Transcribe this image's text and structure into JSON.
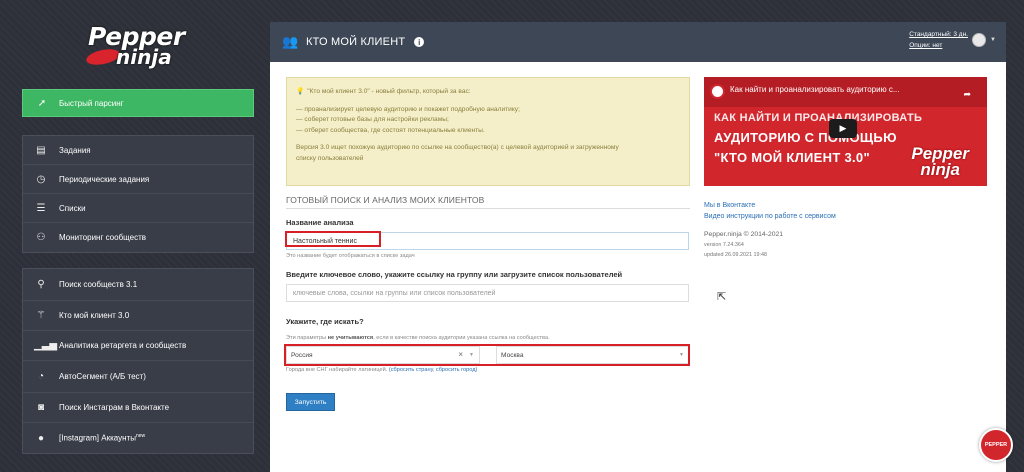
{
  "logo": {
    "line1": "Pepper",
    "line2": "ninja"
  },
  "sidebar": {
    "quick_parse": {
      "label": "Быстрый парсинг",
      "icon": "rocket-icon"
    },
    "group1": [
      {
        "label": "Задания",
        "icon": "tasks-icon"
      },
      {
        "label": "Периодические задания",
        "icon": "clock-icon"
      },
      {
        "label": "Списки",
        "icon": "list-icon"
      },
      {
        "label": "Мониторинг сообществ",
        "icon": "binoculars-icon"
      }
    ],
    "group2": [
      {
        "label": "Поиск сообществ 3.1",
        "icon": "search-icon"
      },
      {
        "label": "Кто мой клиент 3.0",
        "icon": "magic-wand-icon"
      },
      {
        "label": "Аналитика ретаргета и сообществ",
        "icon": "signal-bars-icon"
      },
      {
        "label": "АвтоСегмент (А/Б тест)",
        "icon": "pie-chart-icon"
      },
      {
        "label": "Поиск Инстаграм в Вконтакте",
        "icon": "instagram-icon"
      },
      {
        "label": "[Instagram] Аккаунты",
        "sup": "new",
        "icon": "user-icon"
      }
    ]
  },
  "header": {
    "title": "КТО МОЙ КЛИЕНТ",
    "plan_line1": "Стандартный: 3 дн.",
    "plan_line2": "Опции: нет"
  },
  "notice": {
    "intro": "\"Кто мой клиент 3.0\" - новый фильтр, который за вас:",
    "items": [
      "— проанализирует целевую аудиторию и покажет подробную аналитику;",
      "— соберет готовые базы для настройки рекламы;",
      "— отберет сообщества, где состоят потенциальные клиенты."
    ],
    "desc1": "Версия 3.0 ищет похожую аудиторию по ссылке на сообщество(а) с целевой аудиторией и загруженному",
    "desc2": "списку пользователей"
  },
  "form": {
    "section_title": "ГОТОВЫЙ ПОИСК И АНАЛИЗ МОИХ КЛИЕНТОВ",
    "name_label": "Название анализа",
    "name_value": "Настольный теннис",
    "name_hint": "Это название будет отображаться в списке задач",
    "keyword_label": "Введите ключевое слово, укажите ссылку на группу или загрузите список пользователей",
    "keyword_placeholder": "ключевые слова, ссылки на группы или список пользователей",
    "where_label": "Укажите, где искать?",
    "where_hint_pre": "Эти параметры ",
    "where_hint_bold": "не учитываются",
    "where_hint_post": ", если в качестве поиска аудитории указана ссылка на сообщества.",
    "country_value": "Россия",
    "city_value": "Москва",
    "latin_hint": "Города вне СНГ набирайте латиницей. ",
    "reset_country": "(сбросить страну",
    "reset_city": "сбросить город)",
    "run_label": "Запустить"
  },
  "video": {
    "channel_title": "Как найти и проанализировать аудиторию с...",
    "headline1": "КАК НАЙТИ И ПРОАНАЛИЗИРОВАТЬ",
    "headline2": "АУДИТОРИЮ С ПОМОЩЬЮ",
    "headline3": "\"КТО МОЙ КЛИЕНТ 3.0\"",
    "brand1": "Pepper",
    "brand2": "ninja"
  },
  "right_links": {
    "vk": "Мы в Вконтакте",
    "videos": "Видео инструкции по работе с сервисом",
    "copyright": "Pepper.ninja © 2014-2021",
    "version": "version 7.24.364",
    "updated": "updated 26.09.2021 19:48"
  },
  "badge": "PEPPER"
}
